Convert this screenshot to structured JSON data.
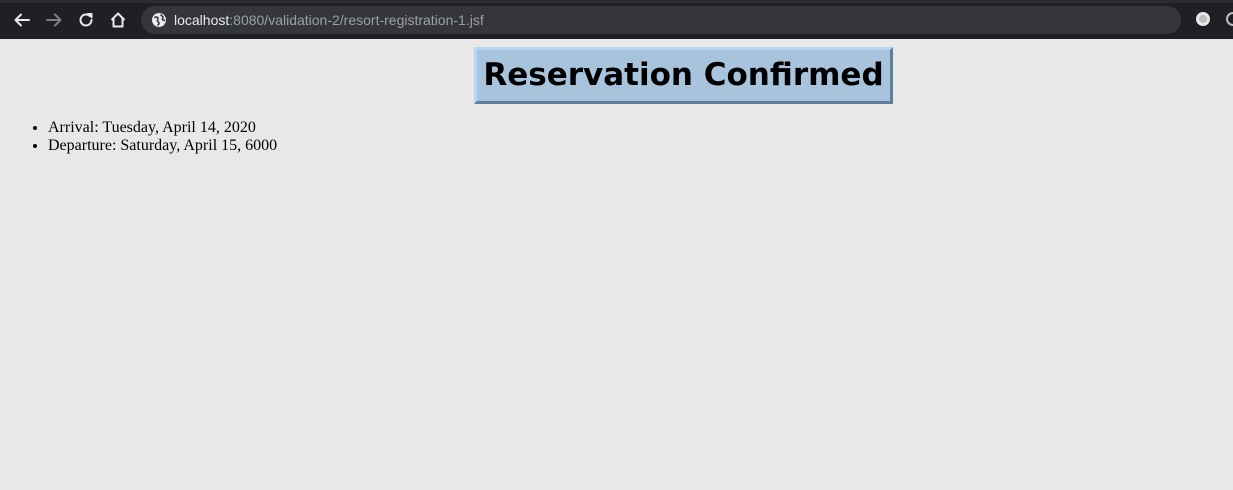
{
  "browser": {
    "url_host": "localhost",
    "url_path": ":8080/validation-2/resort-registration-1.jsf",
    "icons": {
      "back": "arrow-left-icon",
      "forward": "arrow-right-icon",
      "reload": "reload-icon",
      "home": "home-icon",
      "site": "globe-icon",
      "extension_1": "record-icon",
      "extension_2": "circle-icon"
    }
  },
  "page": {
    "title": "Reservation Confirmed",
    "details": [
      {
        "text": "Arrival: Tuesday, April 14, 2020"
      },
      {
        "text": "Departure: Saturday, April 15, 6000"
      }
    ]
  },
  "colors": {
    "page_background": "#e8e8e8",
    "title_background": "#a8c4dc",
    "browser_chrome": "#1f2023",
    "omnibox": "#35363a"
  }
}
